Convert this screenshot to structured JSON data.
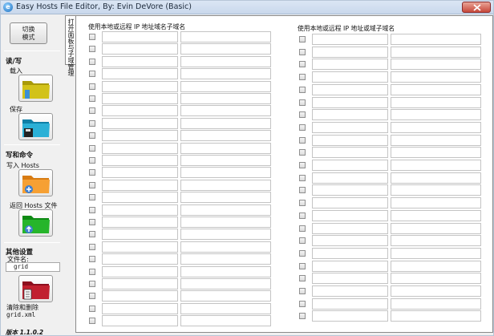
{
  "window": {
    "title": "Easy Hosts File Editor, By: Evin DeVore (Basic)",
    "accent": "#c7483a"
  },
  "left": {
    "switch_label_1": "切换",
    "switch_label_2": "模式",
    "read_write_title": "读/写",
    "load_label": "载入",
    "save_label": "保存",
    "write_title": "写和命令",
    "write_hosts_label": "写入 Hosts",
    "restore_hosts_label": "返回 Hosts 文件",
    "other_title": "其他设置",
    "filename_label": "文件名:",
    "filename_value": "grid",
    "delete_label": "清除和删除",
    "delete_file": "grid.xml",
    "version": "版本 1.1.0.2"
  },
  "tab": {
    "label": "打开面板与子域管理"
  },
  "main": {
    "left_header": "使用本地或远程 IP 地址域名子域名",
    "right_header": "使用本地或远程 IP 地址或域子域名",
    "left_rows": 24,
    "right_rows": 23
  }
}
